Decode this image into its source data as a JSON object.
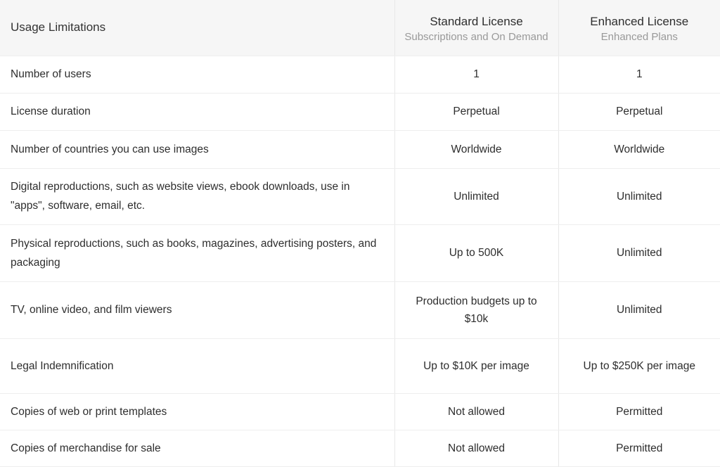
{
  "table": {
    "header": {
      "feature_column_label": "Usage Limitations",
      "plans": [
        {
          "title": "Standard License",
          "subtitle": "Subscriptions and On Demand"
        },
        {
          "title": "Enhanced License",
          "subtitle": "Enhanced Plans"
        }
      ]
    },
    "rows": [
      {
        "feature": "Number of users",
        "standard": "1",
        "enhanced": "1"
      },
      {
        "feature": "License duration",
        "standard": "Perpetual",
        "enhanced": "Perpetual"
      },
      {
        "feature": "Number of countries you can use images",
        "standard": "Worldwide",
        "enhanced": "Worldwide"
      },
      {
        "feature": "Digital reproductions, such as website views, ebook downloads, use in \"apps\", software, email, etc.",
        "standard": "Unlimited",
        "enhanced": "Unlimited"
      },
      {
        "feature": "Physical reproductions, such as books, magazines, advertising posters, and packaging",
        "standard": "Up to 500K",
        "enhanced": "Unlimited"
      },
      {
        "feature": "TV, online video, and film viewers",
        "standard": "Production budgets up to $10k",
        "enhanced": "Unlimited"
      },
      {
        "feature": "Legal Indemnification",
        "standard": "Up to $10K per image",
        "enhanced": "Up to $250K per image"
      },
      {
        "feature": "Copies of web or print templates",
        "standard": "Not allowed",
        "enhanced": "Permitted"
      },
      {
        "feature": "Copies of merchandise for sale",
        "standard": "Not allowed",
        "enhanced": "Permitted"
      }
    ]
  },
  "colors": {
    "header_background": "#f6f6f6",
    "text_primary": "#2e2e2e",
    "text_muted": "#999999",
    "border": "#eeeeee",
    "divider": "#e8e8e8",
    "page_background": "#ffffff"
  }
}
